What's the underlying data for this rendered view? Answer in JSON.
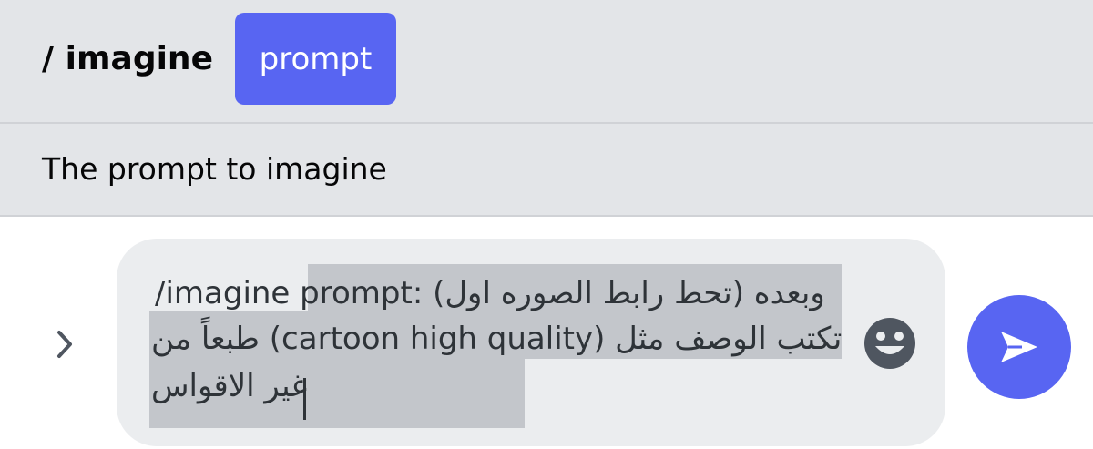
{
  "command_bar": {
    "command": "/ imagine",
    "option_label": "prompt"
  },
  "option_description": "The prompt to imagine",
  "message_input": {
    "line1_command": "/imagine",
    "line1_rest": " prompt: (تحط رابط الصوره اول) وبعده",
    "line2": "طبعاً من (cartoon high quality) تكتب الوصف مثل",
    "line3": "غير الاقواس"
  },
  "icons": {
    "expand": "chevron-right-icon",
    "emoji": "smiling-face-icon",
    "send": "send-arrow-icon"
  },
  "colors": {
    "accent": "#5865f2",
    "panel_bg": "#e3e5e8",
    "input_bg": "#ebedef",
    "selection": "#c3c6cb",
    "text": "#2e3338"
  }
}
